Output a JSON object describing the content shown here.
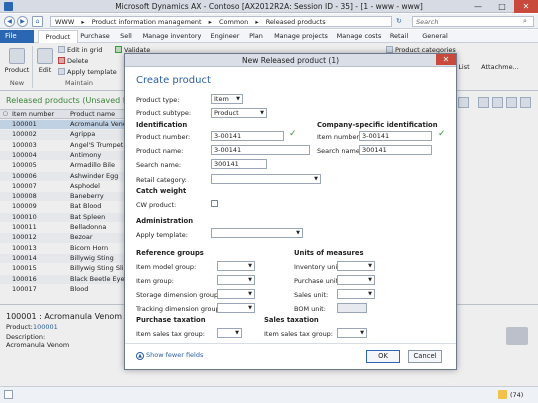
{
  "window": {
    "title": "Microsoft Dynamics AX - Contoso [AX2012R2A: Session ID - 35] - [1 - www - www]",
    "minimize": "—",
    "maximize": "□",
    "close": "✕"
  },
  "address": {
    "crumbs": [
      "WWW",
      "▸",
      "Product information management",
      "▸",
      "Common",
      "▸",
      "Released products"
    ],
    "search_placeholder": "Search"
  },
  "tabs": [
    "File",
    "Product",
    "Purchase",
    "Sell",
    "Manage inventory",
    "Engineer",
    "Plan",
    "Manage projects",
    "Manage costs",
    "Retail",
    "General"
  ],
  "ribbon": {
    "product": "Product",
    "edit": "Edit",
    "edit_in_grid": "Edit in grid",
    "delete": "Delete",
    "apply_template": "Apply template",
    "validate": "Validate",
    "product_categories": "Product categories",
    "list": "List",
    "attachments": "Attachme...",
    "group_new": "New",
    "group_maintain": "Maintain"
  },
  "list": {
    "title": "Released products (Unsaved filt",
    "col_item": "Item number",
    "col_name": "Product name",
    "rows": [
      {
        "item": "100001",
        "name": "Acromanula Venom"
      },
      {
        "item": "100002",
        "name": "Agrippa"
      },
      {
        "item": "100003",
        "name": "Angel'S Trumpet"
      },
      {
        "item": "100004",
        "name": "Antimony"
      },
      {
        "item": "100005",
        "name": "Armadillo Bile"
      },
      {
        "item": "100006",
        "name": "Ashwinder Egg"
      },
      {
        "item": "100007",
        "name": "Asphodel"
      },
      {
        "item": "100008",
        "name": "Baneberry"
      },
      {
        "item": "100009",
        "name": "Bat Blood"
      },
      {
        "item": "100010",
        "name": "Bat Spleen"
      },
      {
        "item": "100011",
        "name": "Belladonna"
      },
      {
        "item": "100012",
        "name": "Bezoar"
      },
      {
        "item": "100013",
        "name": "Bicorn Horn"
      },
      {
        "item": "100014",
        "name": "Billywig Sting"
      },
      {
        "item": "100015",
        "name": "Billywig Sting Slime"
      },
      {
        "item": "100016",
        "name": "Black Beetle Eye"
      },
      {
        "item": "100017",
        "name": "Blood"
      }
    ]
  },
  "preview": {
    "heading": "100001 : Acromanula Venom",
    "product_label": "Product:",
    "product_value": "100001",
    "description_label": "Description:",
    "description_value": "Acromanula Venom"
  },
  "status": {
    "count": "(74)"
  },
  "dialog": {
    "title": "New Released product (1)",
    "close": "✕",
    "heading": "Create product",
    "product_type_label": "Product type:",
    "product_type_value": "Item",
    "product_subtype_label": "Product subtype:",
    "product_subtype_value": "Product",
    "identification": "Identification",
    "product_number_label": "Product number:",
    "product_number_value": "3-00141",
    "product_name_label": "Product name:",
    "product_name_value": "3-00141",
    "search_name_label": "Search name:",
    "search_name_value": "300141",
    "retail_category_label": "Retail category:",
    "company_identification": "Company-specific identification",
    "item_number_label": "Item number:",
    "item_number_value": "3-00141",
    "company_search_name_label": "Search name:",
    "company_search_name_value": "300141",
    "catch_weight": "Catch weight",
    "cw_product_label": "CW product:",
    "administration": "Administration",
    "apply_template_label": "Apply template:",
    "reference_groups": "Reference groups",
    "item_model_group_label": "Item model group:",
    "item_group_label": "Item group:",
    "storage_dimension_label": "Storage dimension group:",
    "tracking_dimension_label": "Tracking dimension group:",
    "units_of_measures": "Units of measures",
    "inventory_unit_label": "Inventory unit:",
    "purchase_unit_label": "Purchase unit:",
    "sales_unit_label": "Sales unit:",
    "bom_unit_label": "BOM unit:",
    "purchase_taxation": "Purchase taxation",
    "item_sales_tax_group_label": "Item sales tax group:",
    "sales_taxation": "Sales taxation",
    "sales_item_sales_tax_group_label": "Item sales tax group:",
    "show_fewer_fields": "Show fewer fields",
    "ok": "OK",
    "cancel": "Cancel"
  }
}
